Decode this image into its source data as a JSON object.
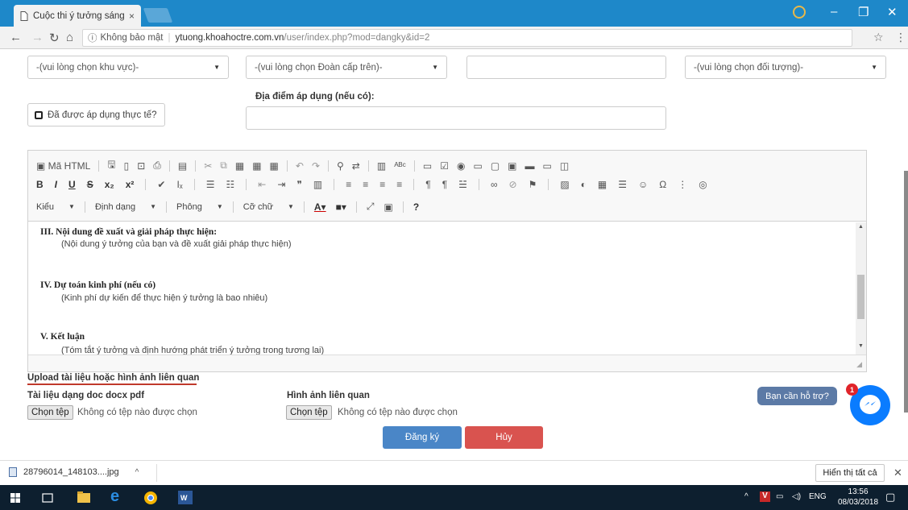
{
  "browser": {
    "tab_title": "Cuộc thi ý tưởng sáng tạ",
    "close_tab": "×",
    "security_label": "Không bảo mật",
    "host": "ytuong.khoahoctre.com.vn",
    "path": "/user/index.php?mod=dangky&id=2",
    "win_min": "–",
    "win_max": "❐",
    "win_close": "✕"
  },
  "form": {
    "region_select": "-(vui lòng chọn khu vực)-",
    "union_select": "-(vui lòng chọn Đoàn cấp trên)-",
    "target_select": "-(vui lòng chọn đối tượng)-",
    "applied_checkbox": "Đã được áp dụng thực tế?",
    "location_label": "Địa điểm áp dụng (nếu có):"
  },
  "editor": {
    "source_button": "Mã HTML",
    "format_style": "Kiểu",
    "format_block": "Định dạng",
    "font": "Phông",
    "size": "Cỡ chữ",
    "content": {
      "s3_title": "III. Nội dung đề xuất và giải pháp thực hiện:",
      "s3_text": "(Nội dung ý tưởng của bạn và đề xuất giải pháp thực hiện)",
      "s4_title": "IV. Dự toán kinh phí (nếu có)",
      "s4_text": "(Kinh phí dự kiến để thực hiện ý tưởng là bao nhiêu)",
      "s5_title": "V. Kết luận",
      "s5_text": "(Tóm tắt ý tưởng và định hướng phát triển ý tưởng trong tương lai)"
    }
  },
  "upload": {
    "title": "Upload tài liệu hoặc hình ảnh liên quan",
    "docs_label": "Tài liệu dạng doc docx pdf",
    "images_label": "Hình ảnh liên quan",
    "choose_file": "Chọn tệp",
    "no_file": "Không có tệp nào được chọn"
  },
  "actions": {
    "register": "Đăng ký",
    "cancel": "Hủy"
  },
  "chat": {
    "help_label": "Bạn cần hỗ trợ?",
    "badge_count": "1"
  },
  "downloads": {
    "filename": "28796014_148103....jpg",
    "show_all": "Hiển thị tất cả",
    "close": "✕"
  },
  "taskbar": {
    "lang": "ENG",
    "time": "13:56",
    "date": "08/03/2018"
  },
  "colors": {
    "chrome_blue": "#1e88c9",
    "register_btn": "#4a86c7",
    "cancel_btn": "#d9534f",
    "messenger": "#0a7cff"
  }
}
